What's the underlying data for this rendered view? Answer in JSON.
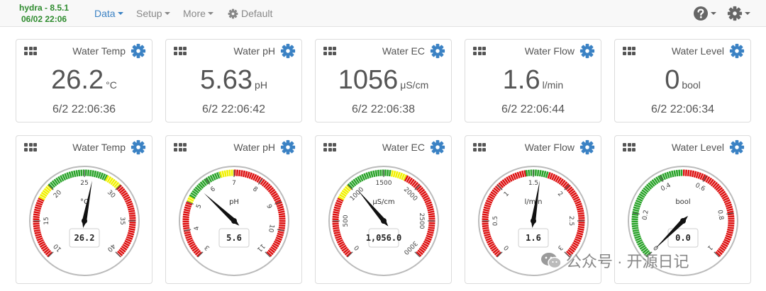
{
  "navbar": {
    "brand_name": "hydra - 8.5.1",
    "brand_date": "06/02 22:06",
    "menu": [
      {
        "label": "Data",
        "active": true
      },
      {
        "label": "Setup"
      },
      {
        "label": "More"
      }
    ],
    "profile_label": "Default"
  },
  "cards": [
    {
      "title": "Water Temp",
      "value": "26.2",
      "unit": "°C",
      "timestamp": "6/2 22:06:36"
    },
    {
      "title": "Water pH",
      "value": "5.63",
      "unit": "pH",
      "timestamp": "6/2 22:06:42"
    },
    {
      "title": "Water EC",
      "value": "1056",
      "unit": "μS/cm",
      "timestamp": "6/2 22:06:38"
    },
    {
      "title": "Water Flow",
      "value": "1.6",
      "unit": "l/min",
      "timestamp": "6/2 22:06:44"
    },
    {
      "title": "Water Level",
      "value": "0",
      "unit": "bool",
      "timestamp": "6/2 22:06:34"
    }
  ],
  "gauges": [
    {
      "title": "Water Temp",
      "unit": "°C",
      "display": "26.2",
      "value": 26.2,
      "min": 10,
      "max": 40,
      "ticks": [
        "10",
        "15",
        "20",
        "25",
        "30",
        "35",
        "40"
      ],
      "zones": [
        {
          "from": 10,
          "to": 18,
          "color": "red"
        },
        {
          "from": 18,
          "to": 20,
          "color": "yellow"
        },
        {
          "from": 20,
          "to": 28,
          "color": "green"
        },
        {
          "from": 28,
          "to": 30,
          "color": "yellow"
        },
        {
          "from": 30,
          "to": 40,
          "color": "red"
        }
      ]
    },
    {
      "title": "Water pH",
      "unit": "pH",
      "display": "5.6",
      "value": 5.6,
      "min": 3,
      "max": 11,
      "ticks": [
        "3",
        "4",
        "5",
        "6",
        "7",
        "8",
        "9",
        "10",
        "11"
      ],
      "zones": [
        {
          "from": 3,
          "to": 5,
          "color": "red"
        },
        {
          "from": 5,
          "to": 5.2,
          "color": "yellow"
        },
        {
          "from": 5.2,
          "to": 6.5,
          "color": "green"
        },
        {
          "from": 6.5,
          "to": 7,
          "color": "yellow"
        },
        {
          "from": 7,
          "to": 11,
          "color": "red"
        }
      ]
    },
    {
      "title": "Water EC",
      "unit": "μS/cm",
      "display": "1,056.0",
      "value": 1056,
      "min": 0,
      "max": 3000,
      "ticks": [
        "0",
        "500",
        "1000",
        "1500",
        "2000",
        "2500",
        "3000"
      ],
      "zones": [
        {
          "from": 0,
          "to": 800,
          "color": "red"
        },
        {
          "from": 800,
          "to": 1000,
          "color": "yellow"
        },
        {
          "from": 1000,
          "to": 1600,
          "color": "green"
        },
        {
          "from": 1600,
          "to": 1800,
          "color": "yellow"
        },
        {
          "from": 1800,
          "to": 3000,
          "color": "red"
        }
      ]
    },
    {
      "title": "Water Flow",
      "unit": "l/min",
      "display": "1.6",
      "value": 1.6,
      "min": 0,
      "max": 3,
      "ticks": [
        "0",
        "0.5",
        "1",
        "1.5",
        "2",
        "2.5",
        "3"
      ],
      "zones": [
        {
          "from": 0,
          "to": 1.4,
          "color": "red"
        },
        {
          "from": 1.4,
          "to": 1.7,
          "color": "green"
        },
        {
          "from": 1.7,
          "to": 3,
          "color": "red"
        }
      ]
    },
    {
      "title": "Water Level",
      "unit": "bool",
      "display": "0.0",
      "value": 0,
      "min": 0,
      "max": 1,
      "ticks": [
        "0",
        "0.2",
        "0.4",
        "0.6",
        "0.8",
        "1"
      ],
      "zones": [
        {
          "from": 0,
          "to": 0.5,
          "color": "green"
        },
        {
          "from": 0.5,
          "to": 1,
          "color": "red"
        }
      ]
    }
  ],
  "colors": {
    "red": "#dd1111",
    "yellow": "#f1f100",
    "green": "#29a329",
    "accent": "#3b82c4",
    "brand": "#2e8b2e"
  },
  "watermark": {
    "text": "公众号 · 开源日记"
  }
}
